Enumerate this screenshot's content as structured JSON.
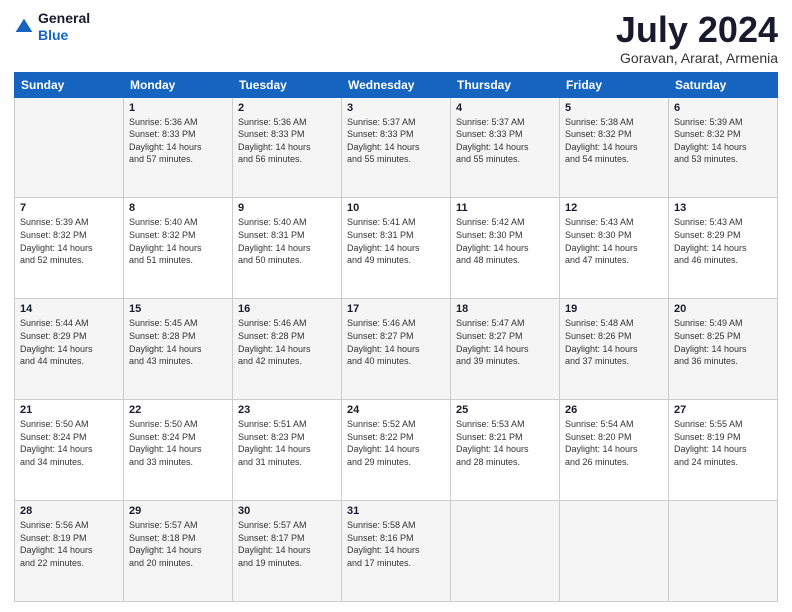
{
  "logo": {
    "general": "General",
    "blue": "Blue"
  },
  "header": {
    "month": "July 2024",
    "location": "Goravan, Ararat, Armenia"
  },
  "days_of_week": [
    "Sunday",
    "Monday",
    "Tuesday",
    "Wednesday",
    "Thursday",
    "Friday",
    "Saturday"
  ],
  "weeks": [
    [
      {
        "day": "",
        "info": ""
      },
      {
        "day": "1",
        "info": "Sunrise: 5:36 AM\nSunset: 8:33 PM\nDaylight: 14 hours\nand 57 minutes."
      },
      {
        "day": "2",
        "info": "Sunrise: 5:36 AM\nSunset: 8:33 PM\nDaylight: 14 hours\nand 56 minutes."
      },
      {
        "day": "3",
        "info": "Sunrise: 5:37 AM\nSunset: 8:33 PM\nDaylight: 14 hours\nand 55 minutes."
      },
      {
        "day": "4",
        "info": "Sunrise: 5:37 AM\nSunset: 8:33 PM\nDaylight: 14 hours\nand 55 minutes."
      },
      {
        "day": "5",
        "info": "Sunrise: 5:38 AM\nSunset: 8:32 PM\nDaylight: 14 hours\nand 54 minutes."
      },
      {
        "day": "6",
        "info": "Sunrise: 5:39 AM\nSunset: 8:32 PM\nDaylight: 14 hours\nand 53 minutes."
      }
    ],
    [
      {
        "day": "7",
        "info": "Sunrise: 5:39 AM\nSunset: 8:32 PM\nDaylight: 14 hours\nand 52 minutes."
      },
      {
        "day": "8",
        "info": "Sunrise: 5:40 AM\nSunset: 8:32 PM\nDaylight: 14 hours\nand 51 minutes."
      },
      {
        "day": "9",
        "info": "Sunrise: 5:40 AM\nSunset: 8:31 PM\nDaylight: 14 hours\nand 50 minutes."
      },
      {
        "day": "10",
        "info": "Sunrise: 5:41 AM\nSunset: 8:31 PM\nDaylight: 14 hours\nand 49 minutes."
      },
      {
        "day": "11",
        "info": "Sunrise: 5:42 AM\nSunset: 8:30 PM\nDaylight: 14 hours\nand 48 minutes."
      },
      {
        "day": "12",
        "info": "Sunrise: 5:43 AM\nSunset: 8:30 PM\nDaylight: 14 hours\nand 47 minutes."
      },
      {
        "day": "13",
        "info": "Sunrise: 5:43 AM\nSunset: 8:29 PM\nDaylight: 14 hours\nand 46 minutes."
      }
    ],
    [
      {
        "day": "14",
        "info": "Sunrise: 5:44 AM\nSunset: 8:29 PM\nDaylight: 14 hours\nand 44 minutes."
      },
      {
        "day": "15",
        "info": "Sunrise: 5:45 AM\nSunset: 8:28 PM\nDaylight: 14 hours\nand 43 minutes."
      },
      {
        "day": "16",
        "info": "Sunrise: 5:46 AM\nSunset: 8:28 PM\nDaylight: 14 hours\nand 42 minutes."
      },
      {
        "day": "17",
        "info": "Sunrise: 5:46 AM\nSunset: 8:27 PM\nDaylight: 14 hours\nand 40 minutes."
      },
      {
        "day": "18",
        "info": "Sunrise: 5:47 AM\nSunset: 8:27 PM\nDaylight: 14 hours\nand 39 minutes."
      },
      {
        "day": "19",
        "info": "Sunrise: 5:48 AM\nSunset: 8:26 PM\nDaylight: 14 hours\nand 37 minutes."
      },
      {
        "day": "20",
        "info": "Sunrise: 5:49 AM\nSunset: 8:25 PM\nDaylight: 14 hours\nand 36 minutes."
      }
    ],
    [
      {
        "day": "21",
        "info": "Sunrise: 5:50 AM\nSunset: 8:24 PM\nDaylight: 14 hours\nand 34 minutes."
      },
      {
        "day": "22",
        "info": "Sunrise: 5:50 AM\nSunset: 8:24 PM\nDaylight: 14 hours\nand 33 minutes."
      },
      {
        "day": "23",
        "info": "Sunrise: 5:51 AM\nSunset: 8:23 PM\nDaylight: 14 hours\nand 31 minutes."
      },
      {
        "day": "24",
        "info": "Sunrise: 5:52 AM\nSunset: 8:22 PM\nDaylight: 14 hours\nand 29 minutes."
      },
      {
        "day": "25",
        "info": "Sunrise: 5:53 AM\nSunset: 8:21 PM\nDaylight: 14 hours\nand 28 minutes."
      },
      {
        "day": "26",
        "info": "Sunrise: 5:54 AM\nSunset: 8:20 PM\nDaylight: 14 hours\nand 26 minutes."
      },
      {
        "day": "27",
        "info": "Sunrise: 5:55 AM\nSunset: 8:19 PM\nDaylight: 14 hours\nand 24 minutes."
      }
    ],
    [
      {
        "day": "28",
        "info": "Sunrise: 5:56 AM\nSunset: 8:19 PM\nDaylight: 14 hours\nand 22 minutes."
      },
      {
        "day": "29",
        "info": "Sunrise: 5:57 AM\nSunset: 8:18 PM\nDaylight: 14 hours\nand 20 minutes."
      },
      {
        "day": "30",
        "info": "Sunrise: 5:57 AM\nSunset: 8:17 PM\nDaylight: 14 hours\nand 19 minutes."
      },
      {
        "day": "31",
        "info": "Sunrise: 5:58 AM\nSunset: 8:16 PM\nDaylight: 14 hours\nand 17 minutes."
      },
      {
        "day": "",
        "info": ""
      },
      {
        "day": "",
        "info": ""
      },
      {
        "day": "",
        "info": ""
      }
    ]
  ]
}
